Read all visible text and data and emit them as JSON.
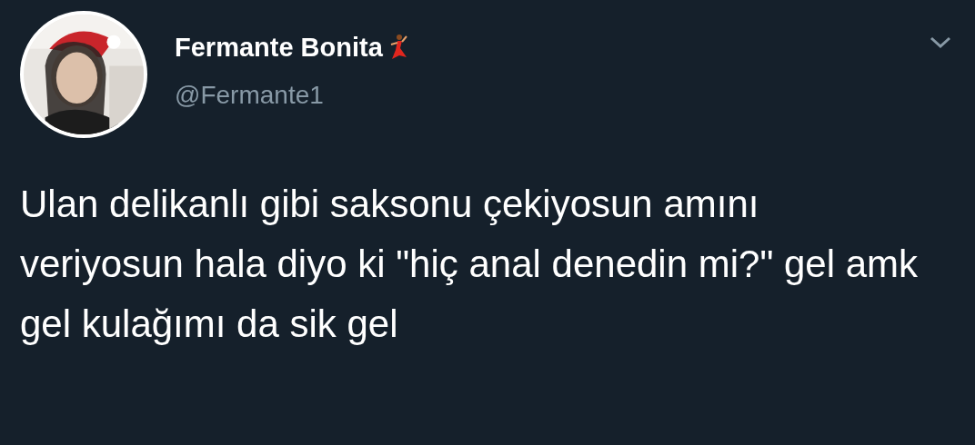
{
  "tweet": {
    "author": {
      "name": "Fermante Bonita",
      "handle": "@Fermante1"
    },
    "text": "Ulan delikanlı gibi saksonu çekiyosun amını veriyosun hala diyo ki \"hiç anal denedin mi?\" gel amk gel kulağımı da sik gel"
  }
}
